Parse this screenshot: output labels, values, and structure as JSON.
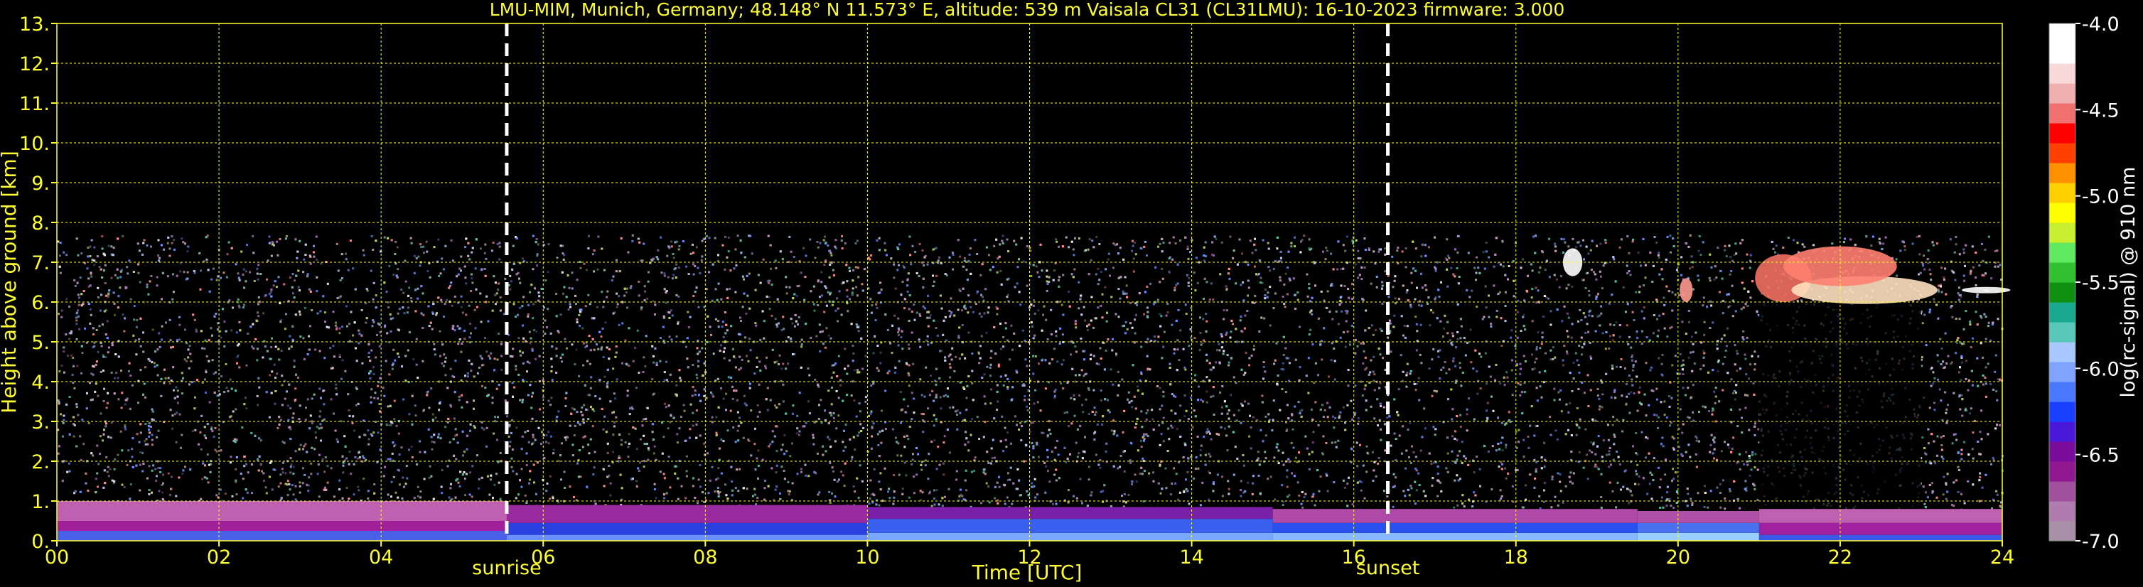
{
  "chart_data": {
    "type": "heatmap",
    "title": "LMU-MIM, Munich, Germany; 48.148° N 11.573° E, altitude: 539 m    Vaisala CL31 (CL31LMU): 16-10-2023    firmware: 3.000",
    "xlabel": "Time [UTC]",
    "ylabel": "Height above ground [km]",
    "xlim": [
      0,
      24
    ],
    "ylim": [
      0,
      13
    ],
    "x_ticks": [
      "00",
      "02",
      "04",
      "06",
      "08",
      "10",
      "12",
      "14",
      "16",
      "18",
      "20",
      "22",
      "24"
    ],
    "y_ticks": [
      "0.",
      "1.",
      "2.",
      "3.",
      "4.",
      "5.",
      "6.",
      "7.",
      "8.",
      "9.",
      "10.",
      "11.",
      "12.",
      "13."
    ],
    "grid": true,
    "markers": [
      {
        "label": "sunrise",
        "x": 5.55
      },
      {
        "label": "sunset",
        "x": 16.42
      }
    ],
    "colorbar": {
      "label": "log(rc-signal) @ 910 nm",
      "range": [
        -7.0,
        -4.0
      ],
      "ticks": [
        "-4.0",
        "-4.5",
        "-5.0",
        "-5.5",
        "-6.0",
        "-6.5",
        "-7.0"
      ],
      "colors": [
        "#a890a8",
        "#b07cb0",
        "#a0509c",
        "#901890",
        "#7a0e9a",
        "#4a18d8",
        "#1a40ff",
        "#4a78ff",
        "#7ea4ff",
        "#a8c8ff",
        "#58c8b8",
        "#1aa890",
        "#109010",
        "#30c030",
        "#60e860",
        "#c8f030",
        "#ffff00",
        "#ffd000",
        "#ff9000",
        "#ff4000",
        "#ff0000",
        "#f07070",
        "#f0b0b0",
        "#f8d8d8",
        "#ffffff",
        "#ffffff"
      ]
    },
    "data_top_km": 7.7,
    "noise_colors": [
      "#b890b8",
      "#90a8e8",
      "#c8c8f0",
      "#6080d8",
      "#d0a0c8",
      "#80b0a8",
      "#e8e8e8",
      "#a070b0",
      "#7090ff",
      "#5cc0a8",
      "#c0d060",
      "#ff9090"
    ],
    "boundary_layer": [
      {
        "x0": 0,
        "x1": 5.55,
        "top": 1.0,
        "layers": [
          {
            "h": 0.25,
            "color": "#4a60e8"
          },
          {
            "h": 0.5,
            "color": "#a0209a"
          },
          {
            "h": 1.0,
            "color": "#c060b0"
          }
        ]
      },
      {
        "x0": 5.55,
        "x1": 10.0,
        "top": 0.9,
        "layers": [
          {
            "h": 0.15,
            "color": "#6a90ff"
          },
          {
            "h": 0.45,
            "color": "#2a40e0"
          },
          {
            "h": 0.9,
            "color": "#9a2aa0"
          }
        ]
      },
      {
        "x0": 10.0,
        "x1": 15.0,
        "top": 0.85,
        "layers": [
          {
            "h": 0.2,
            "color": "#7aa8ff"
          },
          {
            "h": 0.55,
            "color": "#3a60f0"
          },
          {
            "h": 0.85,
            "color": "#7a20a8"
          }
        ]
      },
      {
        "x0": 15.0,
        "x1": 19.5,
        "top": 0.8,
        "layers": [
          {
            "h": 0.2,
            "color": "#88b8ff"
          },
          {
            "h": 0.45,
            "color": "#2a50f0"
          },
          {
            "h": 0.8,
            "color": "#b04aa8"
          }
        ]
      },
      {
        "x0": 19.5,
        "x1": 21.0,
        "top": 0.75,
        "layers": [
          {
            "h": 0.2,
            "color": "#9ad0ff"
          },
          {
            "h": 0.45,
            "color": "#4a70f0"
          },
          {
            "h": 0.75,
            "color": "#b050a8"
          }
        ]
      },
      {
        "x0": 21.0,
        "x1": 24.0,
        "top": 0.8,
        "layers": [
          {
            "h": 0.15,
            "color": "#3a58e8"
          },
          {
            "h": 0.45,
            "color": "#a020a0"
          },
          {
            "h": 0.8,
            "color": "#c060b0"
          }
        ]
      }
    ],
    "clouds": [
      {
        "x": 18.7,
        "y": 7.0,
        "rx": 0.12,
        "ry": 0.35,
        "color": "#ffffff"
      },
      {
        "x": 20.1,
        "y": 6.3,
        "rx": 0.08,
        "ry": 0.3,
        "color": "#ff9a90"
      },
      {
        "x": 21.3,
        "y": 6.6,
        "rx": 0.35,
        "ry": 0.6,
        "color": "#f07060"
      },
      {
        "x": 22.3,
        "y": 6.3,
        "rx": 0.9,
        "ry": 0.35,
        "color": "#ffe0c0"
      },
      {
        "x": 22.0,
        "y": 6.9,
        "rx": 0.7,
        "ry": 0.5,
        "color": "#ff8070"
      },
      {
        "x": 23.8,
        "y": 6.3,
        "rx": 0.3,
        "ry": 0.08,
        "color": "#ffffff"
      }
    ],
    "dark_column": {
      "x0": 21.0,
      "x1": 23.0,
      "y0": 0.8,
      "y1": 6.0
    }
  }
}
